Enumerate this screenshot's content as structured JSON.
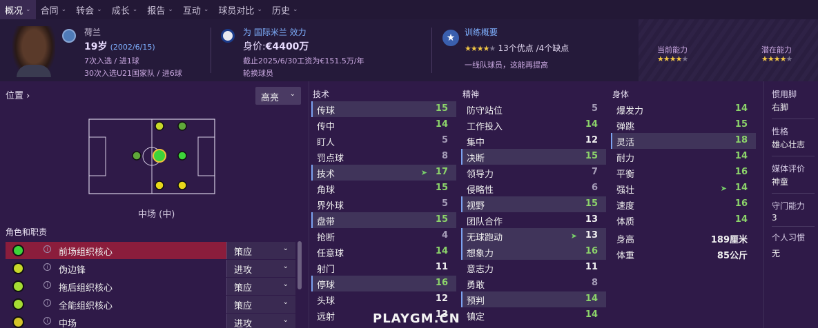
{
  "nav": {
    "tabs": [
      "概况",
      "合同",
      "转会",
      "成长",
      "报告",
      "互动",
      "球员对比",
      "历史"
    ]
  },
  "header": {
    "nation": "荷兰",
    "age": "19岁",
    "dob": "(2002/6/15)",
    "caps": "7次入选 / 进1球",
    "u21": "30次入选U21国家队 / 进6球",
    "club": "为 国际米兰 效力",
    "value_label": "身价:",
    "value": "€4400万",
    "contract": "截止2025/6/30工资为€151.5万/年",
    "status": "轮换球员",
    "training_title": "训练概要",
    "training_summary": "13个优点 /4个缺点",
    "training_note": "一线队球员，这能再提高",
    "current_ability": "当前能力",
    "potential_ability": "潜在能力",
    "stars_training": 3.5,
    "stars_current": 3.5,
    "stars_potential": 3.5
  },
  "left": {
    "position_title": "位置",
    "highlight_label": "高亮",
    "role_label": "中场 (中)",
    "roles_title": "角色和职责",
    "roles": [
      {
        "name": "前场组织核心",
        "duty": "策应",
        "color": "#3dd43a"
      },
      {
        "name": "伪边锋",
        "duty": "进攻",
        "color": "#c8d82a"
      },
      {
        "name": "拖后组织核心",
        "duty": "策应",
        "color": "#a6dc33"
      },
      {
        "name": "全能组织核心",
        "duty": "策应",
        "color": "#a6dc33"
      },
      {
        "name": "中场",
        "duty": "进攻",
        "color": "#d4c52a"
      }
    ]
  },
  "attributes": {
    "technical_title": "技术",
    "technical": [
      [
        "传球",
        15
      ],
      [
        "传中",
        14
      ],
      [
        "盯人",
        5
      ],
      [
        "罚点球",
        8
      ],
      [
        "技术",
        17
      ],
      [
        "角球",
        15
      ],
      [
        "界外球",
        5
      ],
      [
        "盘带",
        15
      ],
      [
        "抢断",
        4
      ],
      [
        "任意球",
        14
      ],
      [
        "射门",
        11
      ],
      [
        "停球",
        16
      ],
      [
        "头球",
        12
      ],
      [
        "远射",
        13
      ]
    ],
    "mental_title": "精神",
    "mental": [
      [
        "防守站位",
        5
      ],
      [
        "工作投入",
        14
      ],
      [
        "集中",
        12
      ],
      [
        "决断",
        15
      ],
      [
        "领导力",
        7
      ],
      [
        "侵略性",
        6
      ],
      [
        "视野",
        15
      ],
      [
        "团队合作",
        13
      ],
      [
        "无球跑动",
        13
      ],
      [
        "想象力",
        16
      ],
      [
        "意志力",
        11
      ],
      [
        "勇敢",
        8
      ],
      [
        "预判",
        14
      ],
      [
        "镇定",
        14
      ]
    ],
    "physical_title": "身体",
    "physical": [
      [
        "爆发力",
        14
      ],
      [
        "弹跳",
        15
      ],
      [
        "灵活",
        18
      ],
      [
        "耐力",
        14
      ],
      [
        "平衡",
        16
      ],
      [
        "强壮",
        14
      ],
      [
        "速度",
        16
      ],
      [
        "体质",
        14
      ]
    ],
    "height_label": "身高",
    "height": "189厘米",
    "weight_label": "体重",
    "weight": "85公斤"
  },
  "info": {
    "foot_label": "惯用脚",
    "foot": "右脚",
    "personality_label": "性格",
    "personality": "雄心壮志",
    "media_label": "媒体评价",
    "media": "神童",
    "gk_label": "守门能力",
    "gk": "3",
    "habits_label": "个人习惯",
    "habits": "无"
  },
  "watermark": "PLAYGM.CN"
}
